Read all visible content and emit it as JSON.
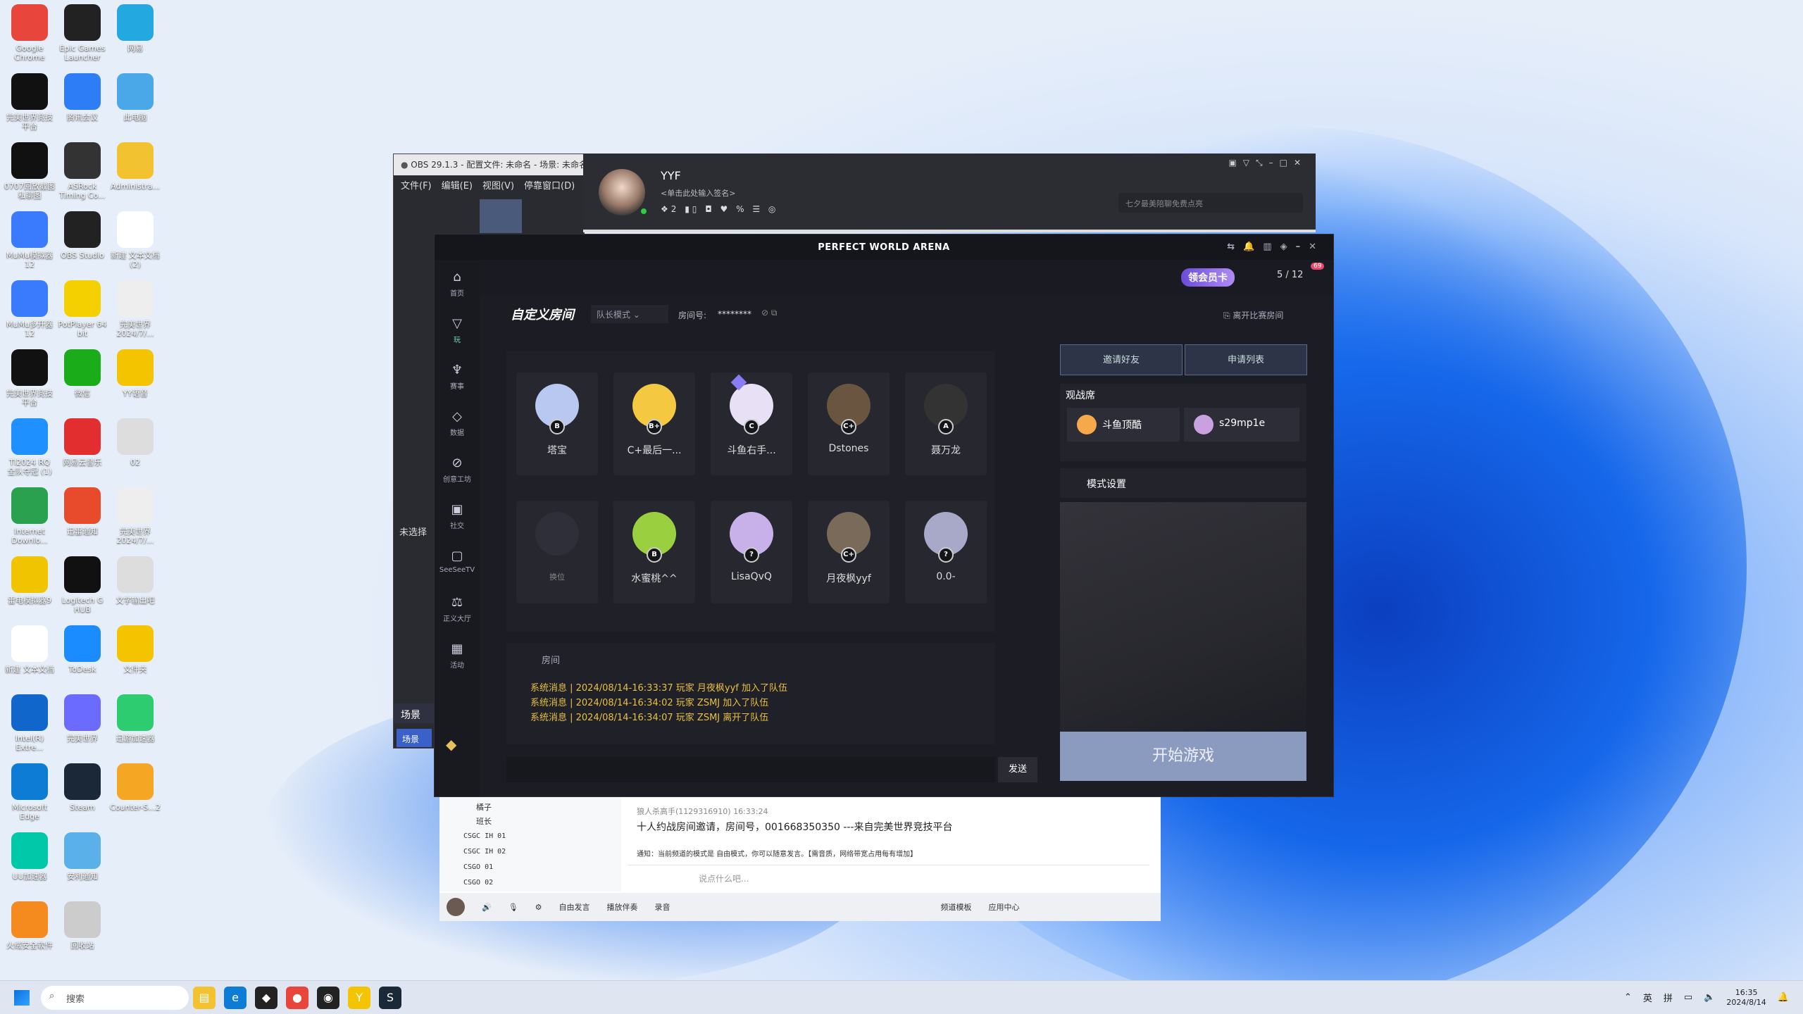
{
  "desktop": {
    "icons": [
      [
        "Google Chrome",
        "#e8453c"
      ],
      [
        "Epic Games Launcher",
        "#222"
      ],
      [
        "网易",
        "#23a8e0"
      ],
      [
        "完美世界竞技平台",
        "#111"
      ],
      [
        "腾讯会议",
        "#2d7df6"
      ],
      [
        "此电脑",
        "#4aa8e8"
      ],
      [
        "0707回放截图 私聊图",
        "#111"
      ],
      [
        "ASRock Timing Co...",
        "#333"
      ],
      [
        "Administra...",
        "#f2c230"
      ],
      [
        "MuMu模拟器12",
        "#3a7bfd"
      ],
      [
        "OBS Studio",
        "#222"
      ],
      [
        "新建 文本文档 (2)",
        "#fff"
      ],
      [
        "MuMu多开器12",
        "#3a7bfd"
      ],
      [
        "PotPlayer 64 bit",
        "#f5d000"
      ],
      [
        "完美世界 2024/7/...",
        "#eee"
      ],
      [
        "完美世界竞技平台",
        "#111"
      ],
      [
        "微信",
        "#1aad19"
      ],
      [
        "YY语音",
        "#f5c400"
      ],
      [
        "TI2024 RQ 全队夺冠 (1)",
        "#1e90ff"
      ],
      [
        "网易云音乐",
        "#e22e2e"
      ],
      [
        "02",
        "#ddd"
      ],
      [
        "Internet Downlo...",
        "#2aa14f"
      ],
      [
        "迅雷通知",
        "#e84a2c"
      ],
      [
        "完美世界 2024/7/...",
        "#eee"
      ],
      [
        "雷电模拟器9",
        "#f1c400"
      ],
      [
        "Logitech G HUB",
        "#111"
      ],
      [
        "文字输出吧",
        "#ddd"
      ],
      [
        "新建 文本文档",
        "#fff"
      ],
      [
        "ToDesk",
        "#1a8cff"
      ],
      [
        "文件夹",
        "#f5c400"
      ],
      [
        "Intel(R) Extre...",
        "#1166cc"
      ],
      [
        "完美世界",
        "#6b6bff"
      ],
      [
        "迅游加速器",
        "#2ecc71"
      ],
      [
        "Microsoft Edge",
        "#0c7cd5"
      ],
      [
        "Steam",
        "#1b2838"
      ],
      [
        "Counter-S...2",
        "#f5a623"
      ],
      [
        "UU加速器",
        "#00c8a8"
      ],
      [
        "安利通知",
        "#5ab0e8"
      ],
      [
        "",
        ""
      ],
      [
        "火绒安全软件",
        "#f58a1f"
      ],
      [
        "回收站",
        "#ccc"
      ],
      [
        "",
        ""
      ]
    ]
  },
  "obs": {
    "title": "OBS 29.1.3 - 配置文件: 未命名 - 场景: 未命名",
    "menu": [
      "文件(F)",
      "编辑(E)",
      "视图(V)",
      "停靠窗口(D)"
    ],
    "scene_label": "未选择",
    "scenes_title": "场景",
    "scene_item": "场景"
  },
  "yy": {
    "name": "YYF",
    "signature": "<单击此处输入签名>",
    "search_placeholder": "七夕最美陪聊免费点亮"
  },
  "pwa": {
    "title": "PERFECT WORLD ARENA",
    "badge": "领会员卡",
    "count": "5 / 12",
    "notif": "69",
    "room_title": "自定义房间",
    "mode": "队长模式",
    "room_no_label": "房间号:",
    "room_no": "********",
    "leave": "离开比赛房间",
    "invite": "邀请好友",
    "apply": "申请列表",
    "spectators_title": "观战席",
    "spectators": [
      "斗鱼顶酷",
      "s29mp1e"
    ],
    "mode_settings": "模式设置",
    "start": "开始游戏",
    "chat_tab": "房间",
    "send": "发送",
    "side": [
      "首页",
      "玩",
      "赛事",
      "数据",
      "创意工坊",
      "社交",
      "SeeSeeTV",
      "正义大厅",
      "活动"
    ],
    "team1": [
      [
        "塔宝",
        "B"
      ],
      [
        "C+最后一...",
        "B+"
      ],
      [
        "斗鱼右手...",
        "C"
      ],
      [
        "Dstones",
        "C+"
      ],
      [
        "聂万龙",
        "A"
      ]
    ],
    "team2": [
      [
        "换位",
        "?"
      ],
      [
        "水蜜桃^^",
        "B"
      ],
      [
        "LisaQvQ",
        "?"
      ],
      [
        "月夜枫yyf",
        "C+"
      ],
      [
        "0.0-",
        "?"
      ]
    ],
    "messages": [
      "系统消息 | 2024/08/14-16:33:37 玩家 月夜枫yyf 加入了队伍",
      "系统消息 | 2024/08/14-16:34:02 玩家 ZSMJ 加入了队伍",
      "系统消息 | 2024/08/14-16:34:07 玩家 ZSMJ 离开了队伍"
    ]
  },
  "yychat": {
    "tree": [
      "橘子",
      "班长",
      "CSGC IH 01",
      "CSGC IH 02",
      "CSGO 01",
      "CSGO 02"
    ],
    "sender": "狼人杀高手(1129316910) 16:33:24",
    "msg": "十人约战房间邀请，房间号，001668350350  ---来自完美世界竞技平台",
    "notice": "通知：当前频道的模式是 自由模式，你可以随意发言。【需音质，网络带宽占用每有增加】",
    "input_ph": "说点什么吧...",
    "bottom": [
      "自由发言",
      "播放伴奏",
      "录音",
      "频道模板",
      "应用中心"
    ]
  },
  "taskbar": {
    "search": "搜索",
    "ime": "英",
    "ime2": "拼",
    "time": "16:35",
    "date": "2024/8/14"
  }
}
